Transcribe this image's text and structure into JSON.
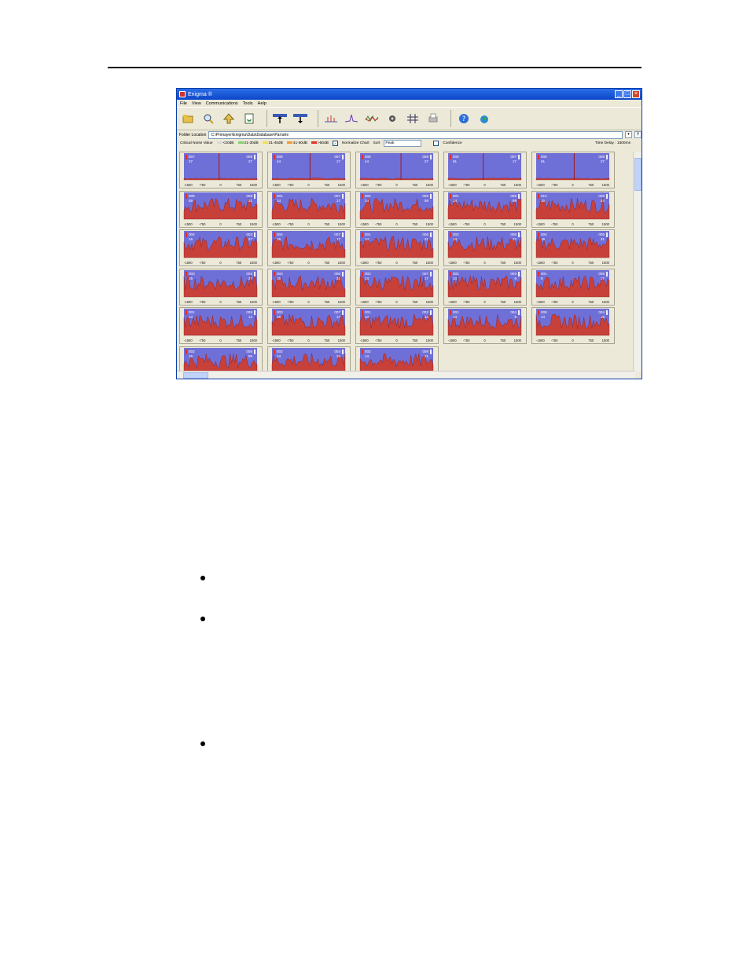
{
  "window": {
    "title": "Enigma ®",
    "menu": [
      "File",
      "View",
      "Communications",
      "Tools",
      "Help"
    ],
    "toolbar_icons": [
      "open-folder-icon",
      "search-icon",
      "upload-icon",
      "refresh-icon",
      "download-logger-icon",
      "upload-logger-icon",
      "spectrum-icon",
      "peak-icon",
      "wave-icon",
      "disc-icon",
      "network-icon",
      "print-icon",
      "help-icon",
      "globe-icon"
    ]
  },
  "location": {
    "label": "Folder Location",
    "path": "C:\\Primayer\\Enigma\\Data\\Database\\Parrahe"
  },
  "legend": {
    "label": "Critical Noise Value",
    "items": [
      {
        "label": "<20dB",
        "color": "#d9d9d9"
      },
      {
        "label": "21-30dB",
        "color": "#7fd36a"
      },
      {
        "label": "31-40dB",
        "color": "#f2e14a"
      },
      {
        "label": "41-50dB",
        "color": "#f59a35"
      },
      {
        "label": ">50dB",
        "color": "#e03030"
      }
    ],
    "normalize_label": "Normalize Chart",
    "sort_label": "Sort",
    "sort_value": "Peak",
    "confidence_label": "Confidence",
    "time_delay": "Time Delay : 1500ms"
  },
  "charts": [
    {
      "a": "007",
      "b": "008",
      "l": "37",
      "r": "27",
      "noise": false,
      "axis": [
        "-1500",
        "-750",
        "0",
        "750",
        "1500"
      ]
    },
    {
      "a": "006",
      "b": "007",
      "l": "44",
      "r": "17",
      "noise": false,
      "axis": [
        "-1500",
        "-750",
        "0",
        "750",
        "1500"
      ]
    },
    {
      "a": "006",
      "b": "008",
      "l": "44",
      "r": "27",
      "noise": false,
      "axis": [
        "-1500",
        "-750",
        "0",
        "750",
        "1500"
      ]
    },
    {
      "a": "006",
      "b": "007",
      "l": "61",
      "r": "17",
      "noise": false,
      "axis": [
        "-1500",
        "-750",
        "0",
        "750",
        "1500"
      ]
    },
    {
      "a": "006",
      "b": "008",
      "l": "61",
      "r": "27",
      "noise": false,
      "axis": [
        "-1500",
        "-750",
        "0",
        "750",
        "1500"
      ]
    },
    {
      "a": "005",
      "b": "008",
      "l": "59",
      "r": "31",
      "noise": true,
      "axis": [
        "-1500",
        "-750",
        "0",
        "750",
        "1500"
      ]
    },
    {
      "a": "001",
      "b": "007",
      "l": "14",
      "r": "17",
      "noise": true,
      "axis": [
        "-1500",
        "-750",
        "0",
        "750",
        "1500"
      ]
    },
    {
      "a": "002",
      "b": "006",
      "l": "14",
      "r": "59",
      "noise": true,
      "axis": [
        "-1500",
        "-750",
        "0",
        "750",
        "1500"
      ]
    },
    {
      "a": "001",
      "b": "005",
      "l": "14",
      "r": "59",
      "noise": true,
      "axis": [
        "-1500",
        "-750",
        "0",
        "750",
        "1500"
      ]
    },
    {
      "a": "010",
      "b": "006",
      "l": "15",
      "r": "44",
      "noise": true,
      "axis": [
        "-1500",
        "-750",
        "0",
        "750",
        "1500"
      ]
    },
    {
      "a": "004",
      "b": "003",
      "l": "15",
      "r": "27",
      "noise": true,
      "axis": [
        "-1500",
        "-750",
        "0",
        "750",
        "1500"
      ]
    },
    {
      "a": "004",
      "b": "007",
      "l": "15",
      "r": "17",
      "noise": true,
      "axis": [
        "-1500",
        "-750",
        "0",
        "750",
        "1500"
      ]
    },
    {
      "a": "001",
      "b": "006",
      "l": "14",
      "r": "31",
      "noise": true,
      "axis": [
        "-1500",
        "-750",
        "0",
        "750",
        "1500"
      ]
    },
    {
      "a": "002",
      "b": "008",
      "l": "14",
      "r": "27",
      "noise": true,
      "axis": [
        "-1500",
        "-750",
        "0",
        "750",
        "1500"
      ]
    },
    {
      "a": "004",
      "b": "005",
      "l": "15",
      "r": "31",
      "noise": true,
      "axis": [
        "-1500",
        "-750",
        "0",
        "750",
        "1500"
      ]
    },
    {
      "a": "003",
      "b": "003",
      "l": "15",
      "r": "27",
      "noise": true,
      "axis": [
        "-1500",
        "-750",
        "0",
        "750",
        "1500"
      ]
    },
    {
      "a": "003",
      "b": "006",
      "l": "15",
      "r": "31",
      "noise": true,
      "axis": [
        "-1500",
        "-750",
        "0",
        "750",
        "1500"
      ]
    },
    {
      "a": "002",
      "b": "007",
      "l": "14",
      "r": "17",
      "noise": true,
      "axis": [
        "-1500",
        "-750",
        "0",
        "750",
        "1500"
      ]
    },
    {
      "a": "002",
      "b": "003",
      "l": "14",
      "r": "6",
      "noise": true,
      "axis": [
        "-1500",
        "-750",
        "0",
        "750",
        "1500"
      ]
    },
    {
      "a": "001",
      "b": "008",
      "l": "8",
      "r": "27",
      "noise": true,
      "axis": [
        "-1500",
        "-750",
        "0",
        "750",
        "1500"
      ]
    },
    {
      "a": "001",
      "b": "009",
      "l": "14",
      "r": "14",
      "noise": true,
      "axis": [
        "-1500",
        "-750",
        "0",
        "750",
        "1500"
      ]
    },
    {
      "a": "003",
      "b": "007",
      "l": "15",
      "r": "17",
      "noise": true,
      "axis": [
        "-1500",
        "-750",
        "0",
        "750",
        "1500"
      ]
    },
    {
      "a": "001",
      "b": "002",
      "l": "14",
      "r": "14",
      "noise": true,
      "axis": [
        "-1500",
        "-750",
        "0",
        "750",
        "1500"
      ]
    },
    {
      "a": "001",
      "b": "004",
      "l": "14",
      "r": "5",
      "noise": true,
      "axis": [
        "-1500",
        "-750",
        "0",
        "750",
        "1500"
      ]
    },
    {
      "a": "009",
      "b": "004",
      "l": "14",
      "r": "15",
      "noise": true,
      "axis": [
        "-1500",
        "-750",
        "0",
        "750",
        "1500"
      ]
    },
    {
      "a": "002",
      "b": "005",
      "l": "15",
      "r": "59",
      "noise": true,
      "axis": []
    },
    {
      "a": "002",
      "b": "004",
      "l": "14",
      "r": "15",
      "noise": true,
      "axis": []
    },
    {
      "a": "002",
      "b": "008",
      "l": "14",
      "r": "31",
      "noise": true,
      "axis": []
    }
  ]
}
